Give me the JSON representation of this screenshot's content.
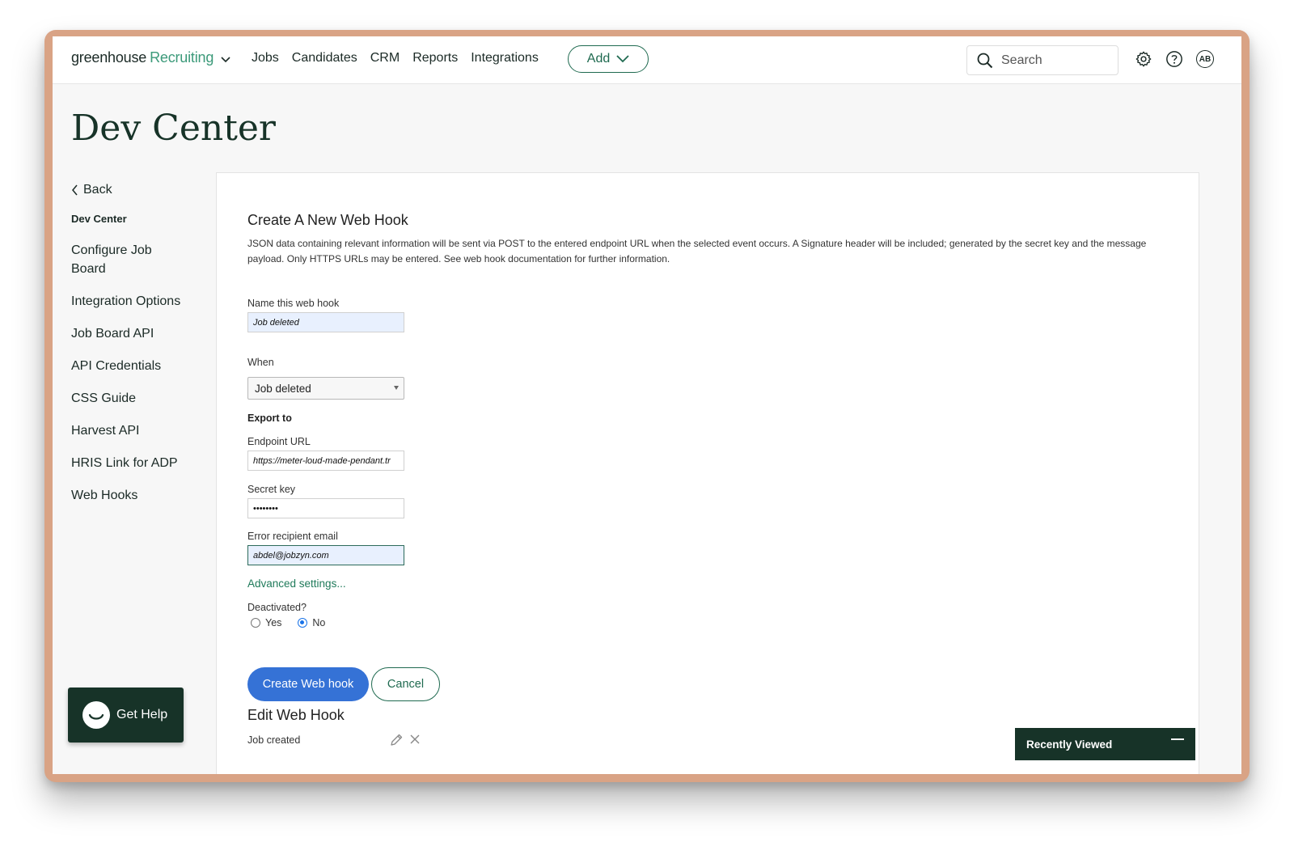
{
  "brand": {
    "name": "greenhouse",
    "product": "Recruiting"
  },
  "nav": {
    "links": [
      "Jobs",
      "Candidates",
      "CRM",
      "Reports",
      "Integrations"
    ],
    "add_label": "Add",
    "search_placeholder": "Search",
    "avatar_initials": "AB"
  },
  "page_title": "Dev Center",
  "sidebar": {
    "back_label": "Back",
    "section_title": "Dev Center",
    "items": [
      "Configure Job Board",
      "Integration Options",
      "Job Board API",
      "API Credentials",
      "CSS Guide",
      "Harvest API",
      "HRIS Link for ADP",
      "Web Hooks"
    ]
  },
  "form": {
    "heading": "Create A New Web Hook",
    "description": "JSON data containing relevant information will be sent via POST to the entered endpoint URL when the selected event occurs. A Signature header will be included; generated by the secret key and the message payload. Only HTTPS URLs may be entered. See web hook documentation for further information.",
    "name_label": "Name this web hook",
    "name_value": "Job deleted",
    "when_label": "When",
    "when_value": "Job deleted",
    "export_label": "Export to",
    "endpoint_label": "Endpoint URL",
    "endpoint_value": "https://meter-loud-made-pendant.tr",
    "secret_label": "Secret key",
    "secret_value": "••••••••",
    "email_label": "Error recipient email",
    "email_value": "abdel@jobzyn.com",
    "advanced_label": "Advanced settings...",
    "deactivated_label": "Deactivated?",
    "yes_label": "Yes",
    "no_label": "No",
    "create_label": "Create Web hook",
    "cancel_label": "Cancel"
  },
  "edit": {
    "heading": "Edit Web Hook",
    "hooks": [
      "Job created"
    ]
  },
  "get_help_label": "Get Help",
  "recently_viewed_label": "Recently Viewed",
  "colors": {
    "brand_dark": "#173328",
    "accent_green": "#1f6a50",
    "primary_blue": "#3572d6",
    "frame": "#d9a385"
  }
}
